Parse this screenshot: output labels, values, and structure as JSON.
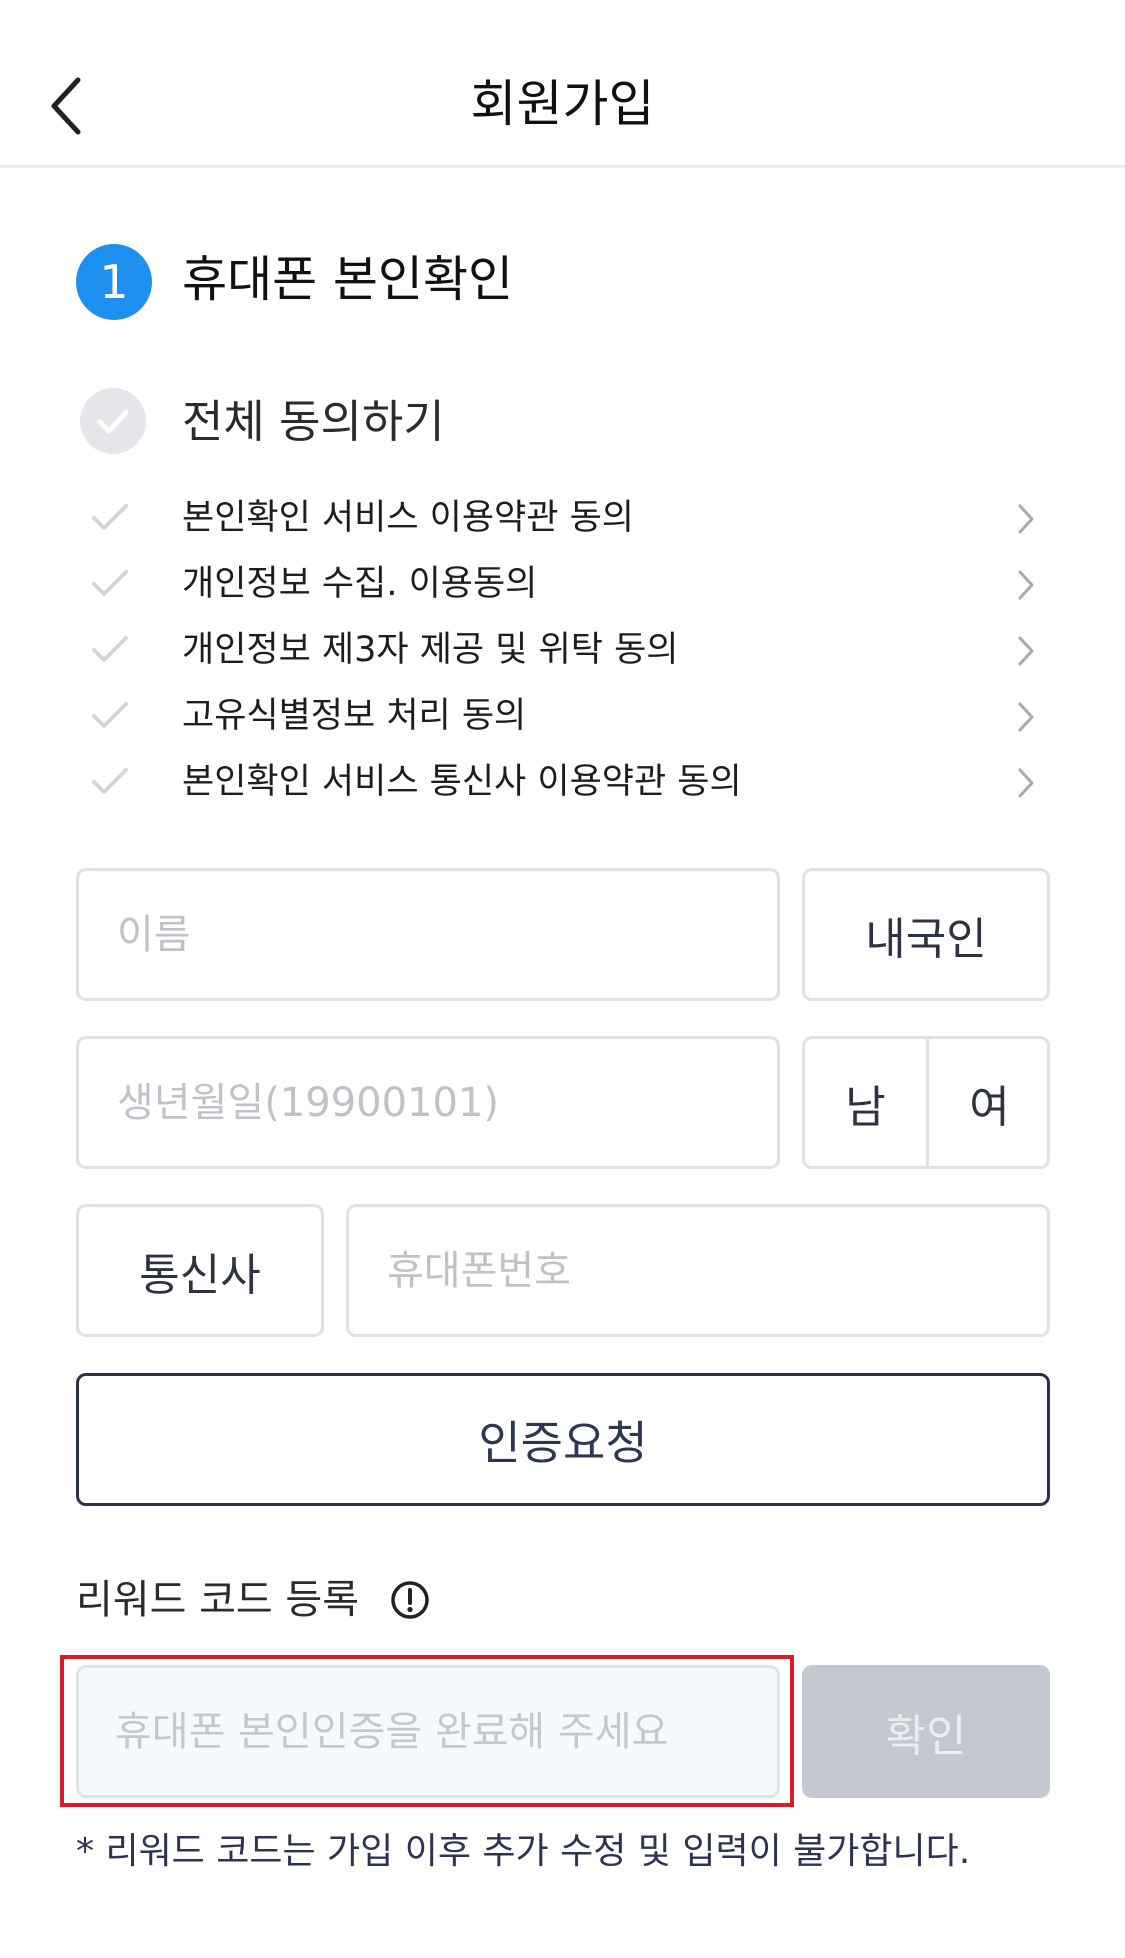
{
  "header": {
    "title": "회원가입",
    "back_icon": "chevron-left-icon"
  },
  "step": {
    "number": "1",
    "title": "휴대폰 본인확인",
    "accent_color": "#1e90f0"
  },
  "agreement": {
    "all_label": "전체 동의하기",
    "terms": [
      {
        "label": "본인확인 서비스 이용약관 동의"
      },
      {
        "label": "개인정보 수집. 이용동의"
      },
      {
        "label": "개인정보 제3자 제공 및 위탁 동의"
      },
      {
        "label": "고유식별정보 처리 동의"
      },
      {
        "label": "본인확인 서비스 통신사 이용약관 동의"
      }
    ]
  },
  "form": {
    "name_placeholder": "이름",
    "nationality_label": "내국인",
    "birth_placeholder": "생년월일(19900101)",
    "gender_male": "남",
    "gender_female": "여",
    "carrier_label": "통신사",
    "phone_placeholder": "휴대폰번호",
    "request_button": "인증요청"
  },
  "reward": {
    "label": "리워드 코드 등록",
    "input_placeholder": "휴대폰 본인인증을 완료해 주세요",
    "confirm_button": "확인",
    "note": "* 리워드 코드는 가입 이후 추가 수정 및 입력이 불가합니다.",
    "highlight_color": "#e0182a"
  }
}
